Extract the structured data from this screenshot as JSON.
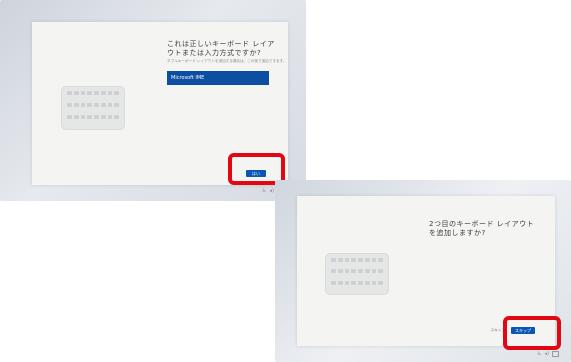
{
  "screen_1": {
    "title": "これは正しいキーボード レイアウトまたは入力方式ですか?",
    "subtitle": "ダブルキーボード レイアウトを追加する場合は、この後で追加できます。",
    "selected_layout": "Microsoft IME",
    "next_button_label": "はい",
    "highlight_color": "#e30613"
  },
  "screen_2": {
    "title": "2つ目のキーボード レイアウトを追加しますか?",
    "skip_button_label": "スキップ",
    "next_button_label": "スキップ",
    "highlight_color": "#e30613"
  },
  "colors": {
    "accent": "#0b4ea2",
    "page_bg": "#f4f4f2"
  },
  "icons": [
    "keyboard-illustration-icon",
    "accessibility-icon",
    "volume-icon"
  ]
}
